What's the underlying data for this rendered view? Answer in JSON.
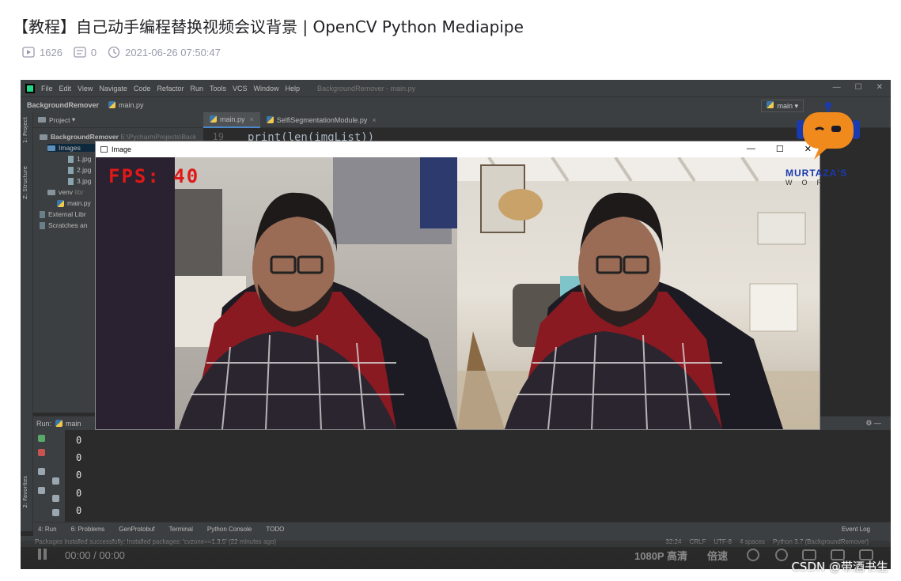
{
  "article": {
    "title": "【教程】自己动手编程替换视频会议背景 | OpenCV Python Mediapipe",
    "views": "1626",
    "comments": "0",
    "date": "2021-06-26 07:50:47"
  },
  "ide": {
    "menu": [
      "File",
      "Edit",
      "View",
      "Navigate",
      "Code",
      "Refactor",
      "Run",
      "Tools",
      "VCS",
      "Window",
      "Help"
    ],
    "window_title": "BackgroundRemover - main.py",
    "breadcrumb_project": "BackgroundRemover",
    "breadcrumb_file": "main.py",
    "run_config": "main",
    "project_panel": {
      "header": "Project",
      "tree": [
        {
          "label": "BackgroundRemover",
          "path": "E:\\PycharmProjects\\Back"
        },
        {
          "label": "Images"
        },
        {
          "label": "1.jpg"
        },
        {
          "label": "2.jpg"
        },
        {
          "label": "3.jpg"
        },
        {
          "label": "venv",
          "path": "libr"
        },
        {
          "label": "main.py"
        },
        {
          "label": "External Libr"
        },
        {
          "label": "Scratches an"
        }
      ]
    },
    "side_labels": [
      "1: Project",
      "Z: Structure",
      "2: Favorites"
    ],
    "tabs": [
      "main.py",
      "SelfiSegmentationModule.py"
    ],
    "code": {
      "line_number": "19",
      "text": "print(len(imgList))"
    },
    "run": {
      "label": "Run:",
      "config": "main",
      "output": [
        "0",
        "0",
        "0",
        "0",
        "0"
      ]
    },
    "bottom_tabs": [
      "4: Run",
      "6: Problems",
      "GenProtobuf",
      "Terminal",
      "Python Console",
      "TODO"
    ],
    "event_log": "Event Log",
    "status": {
      "message": "Packages installed successfully: Installed packages: 'cvzone==1.3.5' (22 minutes ago)",
      "position": "32:24",
      "line_ending": "CRLF",
      "encoding": "UTF-8",
      "indent": "4 spaces",
      "interpreter": "Python 3.7 (BackgroundRemover)"
    }
  },
  "cv_window": {
    "title": "Image",
    "controls": [
      "—",
      "☐",
      "✕"
    ],
    "fps_text": "FPS: 40"
  },
  "player": {
    "time": "00:00 / 00:00",
    "quality": "1080P 高清",
    "speed": "倍速"
  },
  "watermark": {
    "brand": "MURTAZA'S",
    "sub": "WOR",
    "csdn": "CSDN @带酒书生"
  },
  "colors": {
    "ide_bg": "#2b2b2b",
    "ide_panel": "#3c3f41",
    "fps_red": "#e01818",
    "logo_orange": "#f08a1c"
  }
}
